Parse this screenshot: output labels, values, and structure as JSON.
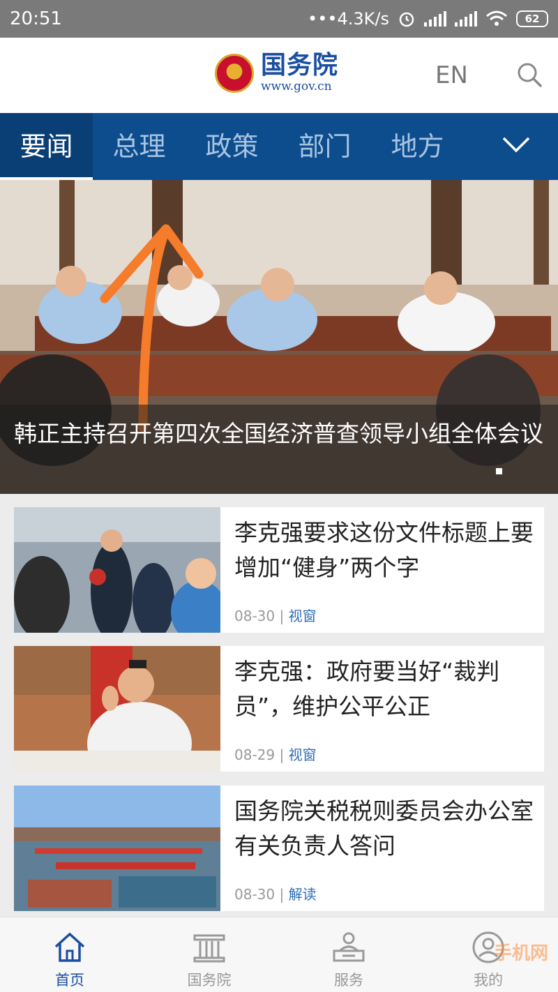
{
  "statusbar": {
    "time": "20:51",
    "network": "•••4.3K/s",
    "battery": "62"
  },
  "header": {
    "logo_title": "国务院",
    "logo_url": "www.gov.cn",
    "lang_label": "EN"
  },
  "nav": {
    "tabs": [
      {
        "label": "要闻"
      },
      {
        "label": "总理"
      },
      {
        "label": "政策"
      },
      {
        "label": "部门"
      },
      {
        "label": "地方"
      }
    ]
  },
  "hero": {
    "caption": "韩正主持召开第四次全国经济普查领导小组全体会议"
  },
  "news": [
    {
      "title": "李克强要求这份文件标题上要增加“健身”两个字",
      "date": "08-30",
      "source": "视窗"
    },
    {
      "title": "李克强：政府要当好“裁判员”，维护公平公正",
      "date": "08-29",
      "source": "视窗"
    },
    {
      "title": "国务院关税税则委员会办公室有关负责人答问",
      "date": "08-30",
      "source": "解读"
    }
  ],
  "bottombar": {
    "items": [
      {
        "label": "首页"
      },
      {
        "label": "国务院"
      },
      {
        "label": "服务"
      },
      {
        "label": "我的"
      }
    ]
  },
  "watermark": "手机网",
  "colors": {
    "brand_blue": "#0d4d8d",
    "logo_blue": "#1a4ea0",
    "arrow_orange": "#f47c2a"
  }
}
